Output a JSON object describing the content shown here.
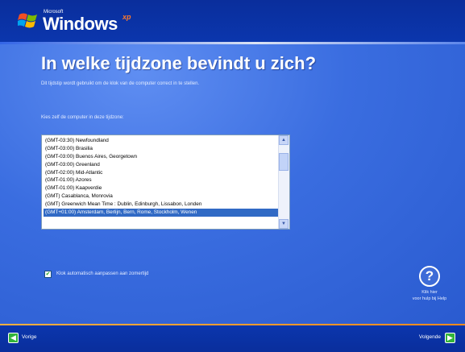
{
  "window": {
    "brand_small": "Microsoft",
    "brand": "Windows",
    "brand_suffix": "xp"
  },
  "page": {
    "title": "In welke tijdzone bevindt u zich?",
    "description": "Dit tijdstip wordt gebruikt om de klok van de computer correct in te stellen.",
    "list_label": "Kies zelf de computer in deze tijdzone:"
  },
  "timezones": [
    {
      "label": "(GMT-03:30) Newfoundland"
    },
    {
      "label": "(GMT-03:00) Brasilia"
    },
    {
      "label": "(GMT-03:00) Buenos Aires, Georgetown"
    },
    {
      "label": "(GMT-03:00) Greenland"
    },
    {
      "label": "(GMT-02:00) Mid-Atlantic"
    },
    {
      "label": "(GMT-01:00) Azores"
    },
    {
      "label": "(GMT-01:00) Kaapverdie"
    },
    {
      "label": "(GMT) Casablanca, Monrovia"
    },
    {
      "label": "(GMT) Greenwich Mean Time : Dublin, Edinburgh, Lissabon, Londen"
    },
    {
      "label": "(GMT+01:00) Amsterdam, Berlijn, Bern, Rome, Stockholm, Wenen",
      "selected": true
    }
  ],
  "dst": {
    "checked": true,
    "check_mark": "✔",
    "label": "Klok automatisch aanpassen aan zomertijd"
  },
  "help": {
    "icon_glyph": "?",
    "label_line1": "Klik hier",
    "label_line2": "voor hulp bij Help"
  },
  "nav": {
    "back_label": "Vorige",
    "back_glyph": "◀",
    "next_label": "Volgende",
    "next_glyph": "▶"
  },
  "scrollbar": {
    "up_glyph": "▲",
    "down_glyph": "▼"
  }
}
